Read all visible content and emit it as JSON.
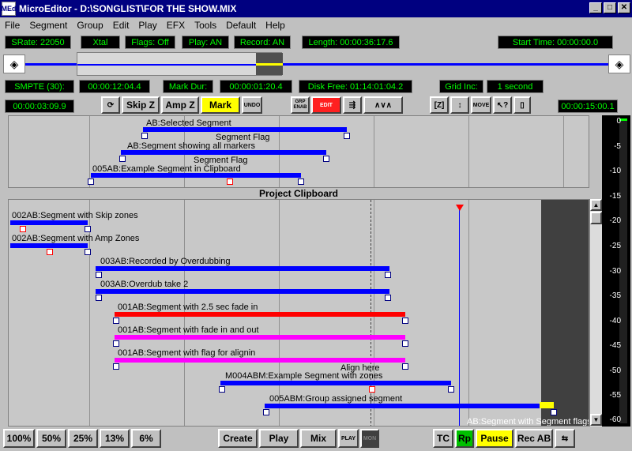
{
  "titlebar": {
    "title": "MicroEditor - D:\\SONGLIST\\FOR THE SHOW.MIX",
    "app_icon": "MEd",
    "minimize": "_",
    "maximize": "□",
    "close": "✕"
  },
  "menu": [
    "File",
    "Segment",
    "Group",
    "Edit",
    "Play",
    "EFX",
    "Tools",
    "Default",
    "Help"
  ],
  "status": {
    "srate": "SRate: 22050",
    "xtal": "Xtal",
    "flags": "Flags: Off",
    "play": "Play: AN",
    "record": "Record: AN",
    "length": "Length: 00:00:36:17.6",
    "start_time": "Start Time: 00:00:00.0"
  },
  "timecodes": {
    "smpte": "SMPTE (30):",
    "smpte_val": "00:00:12:04.4",
    "mark_dur": "Mark Dur:",
    "mark_dur_val": "00:00:01:20.4",
    "disk_free": "Disk Free: 01:14:01:04.2",
    "grid_inc": "Grid Inc:",
    "grid_inc_val": "1 second",
    "left_time": "00:00:03:09.9",
    "right_time": "00:00:15:00.1"
  },
  "toolbar": {
    "skipz": "Skip Z",
    "ampz": "Amp Z",
    "mark": "Mark",
    "undo": "UNDO",
    "grp": "GRP ENAB",
    "edit": "EDIT",
    "move": "MOVE"
  },
  "clipboard": {
    "title": "Project Clipboard",
    "segments": [
      {
        "label": "AB:Selected Segment",
        "flag": "Segment Flag"
      },
      {
        "label": "AB:Segment showing all markers",
        "flag": "Segment Flag"
      },
      {
        "label": "005AB:Example Segment in Clipboard"
      }
    ]
  },
  "project": {
    "segments": [
      {
        "label": "002AB:Segment with Skip zones",
        "color": "#0000ff"
      },
      {
        "label": "002AB:Segment with Amp Zones",
        "color": "#0000ff"
      },
      {
        "label": "003AB:Recorded by Overdubbing",
        "color": "#0000ff"
      },
      {
        "label": "003AB:Overdub take 2",
        "color": "#0000ff"
      },
      {
        "label": "001AB:Segment with 2.5 sec fade in",
        "color": "#ff0000"
      },
      {
        "label": "001AB:Segment with fade in and out",
        "color": "#ff00ff"
      },
      {
        "label": "001AB:Segment with flag for alignin",
        "color": "#ff00ff",
        "flag": "Align here"
      },
      {
        "label": "M004ABM:Example Segment with zones",
        "color": "#0000ff"
      },
      {
        "label": "005ABM:Group assigned  segment",
        "color": "#0000ff"
      },
      {
        "label": "AB:Segment with Segment flags",
        "color": "#0000ff"
      }
    ]
  },
  "meter": {
    "labels": [
      "0",
      "-5",
      "-10",
      "-15",
      "-20",
      "-25",
      "-30",
      "-35",
      "-40",
      "-45",
      "-50",
      "-55",
      "-60"
    ]
  },
  "bottom": {
    "zoom": [
      "100%",
      "50%",
      "25%",
      "13%",
      "6%"
    ],
    "create": "Create",
    "play": "Play",
    "mix": "Mix",
    "play_small": "PLAY",
    "mon": "MON",
    "tc": "TC",
    "rp": "Rp",
    "pause": "Pause",
    "recab": "Rec AB"
  }
}
